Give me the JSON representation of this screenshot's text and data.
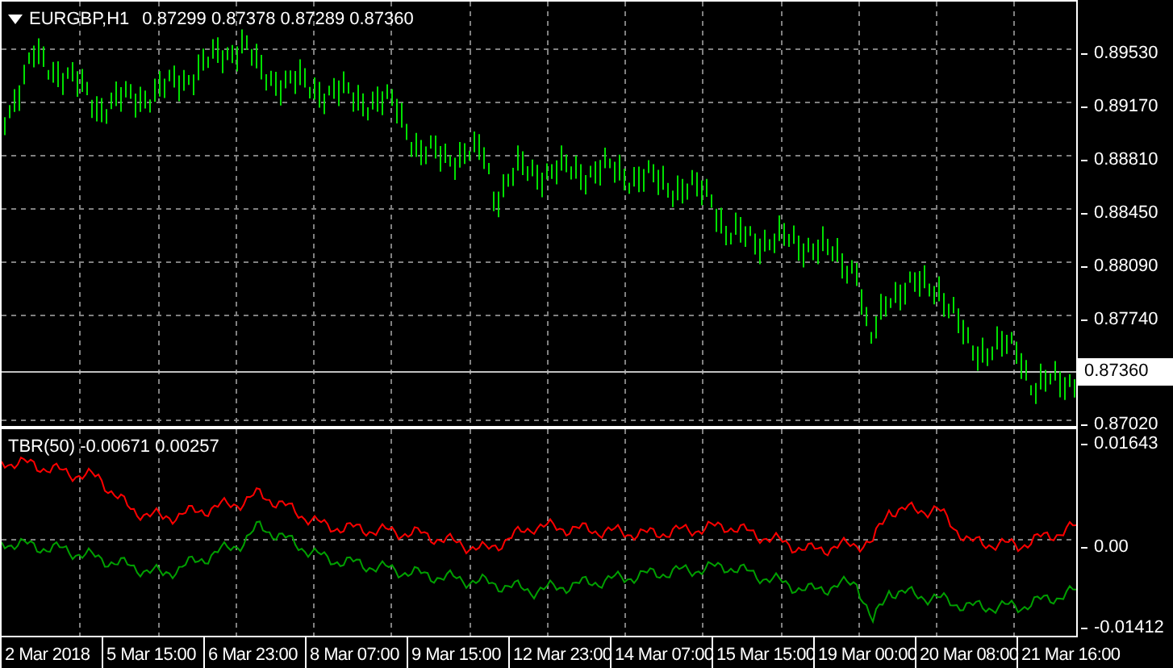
{
  "main_chart": {
    "symbol": "EURGBP,H1",
    "ohlc": "0.87299 0.87378 0.87289 0.87360",
    "price_axis": [
      "0.89530",
      "0.89170",
      "0.88810",
      "0.88450",
      "0.88090",
      "0.87740",
      "0.87020"
    ],
    "current_price": "0.87360"
  },
  "indicator": {
    "header": "TBR(50) -0.00671 0.00257",
    "axis": [
      "0.01643",
      "0.00",
      "-0.01412"
    ]
  },
  "time_axis": [
    "2 Mar 2018",
    "5 Mar 15:00",
    "6 Mar 23:00",
    "8 Mar 07:00",
    "9 Mar 15:00",
    "12 Mar 23:00",
    "14 Mar 07:00",
    "15 Mar 15:00",
    "19 Mar 00:00",
    "20 Mar 08:00",
    "21 Mar 16:00"
  ]
}
